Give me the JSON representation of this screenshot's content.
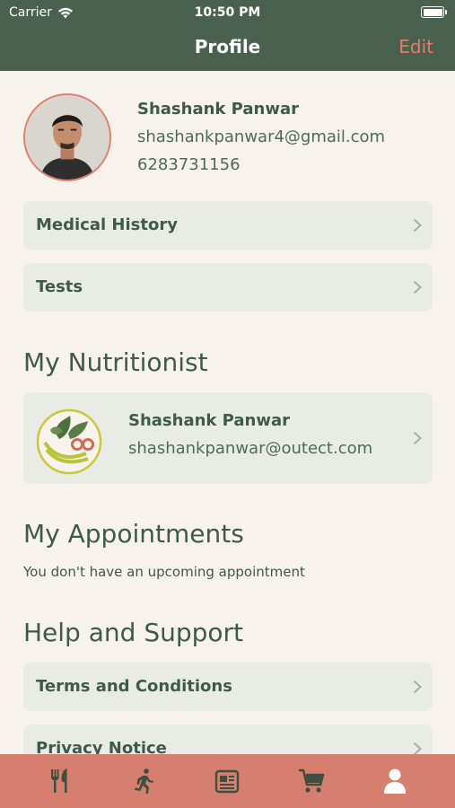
{
  "status_bar": {
    "carrier": "Carrier",
    "time": "10:50 PM"
  },
  "nav": {
    "title": "Profile",
    "edit_label": "Edit"
  },
  "profile": {
    "name": "Shashank Panwar",
    "email": "shashankpanwar4@gmail.com",
    "phone": "6283731156"
  },
  "menu": {
    "medical_history": "Medical History",
    "tests": "Tests"
  },
  "nutritionist_section": {
    "title": "My Nutritionist",
    "name": "Shashank Panwar",
    "email": "shashankpanwar@outect.com"
  },
  "appointments_section": {
    "title": "My Appointments",
    "empty_text": "You don't have an upcoming appointment"
  },
  "help_section": {
    "title": "Help and Support",
    "terms": "Terms and Conditions",
    "privacy": "Privacy Notice"
  },
  "tabs": [
    "fork-knife-icon",
    "running-person-icon",
    "newspaper-icon",
    "cart-icon",
    "user-icon"
  ],
  "colors": {
    "header": "#4a6150",
    "accent": "#e07f69",
    "background": "#f7f3ec",
    "card": "#e9ece4",
    "tabbar": "#d77f6f"
  }
}
